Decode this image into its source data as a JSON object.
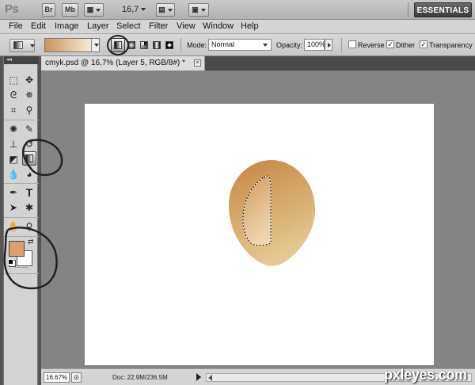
{
  "app": {
    "logo": "Ps"
  },
  "appbar": {
    "br_label": "Br",
    "mb_label": "Mb",
    "zoom_level": "16,7",
    "workspace": "ESSENTIALS"
  },
  "menu": [
    "File",
    "Edit",
    "Image",
    "Layer",
    "Select",
    "Filter",
    "View",
    "Window",
    "Help"
  ],
  "options": {
    "mode_label": "Mode:",
    "mode_value": "Normal",
    "opacity_label": "Opacity:",
    "opacity_value": "100%",
    "reverse_label": "Reverse",
    "dither_label": "Dither",
    "transparency_label": "Transparency",
    "reverse_checked": false,
    "dither_checked": true,
    "transparency_checked": true,
    "gradient_colors": [
      "#c8955e",
      "#f6ead9"
    ]
  },
  "tools_header": "◂◂",
  "document": {
    "tab_title": "cmyk.psd @ 16,7% (Layer 5, RGB/8#) *",
    "close_symbol": "×"
  },
  "colors": {
    "foreground": "#d9a16a",
    "background": "#ffffff",
    "egg_top": "#c6853e",
    "egg_bottom": "#e4c891"
  },
  "status": {
    "zoom": "16.67%",
    "doc_info": "Doc: 22.9M/236.5M"
  },
  "watermark": "pxleyes.com"
}
